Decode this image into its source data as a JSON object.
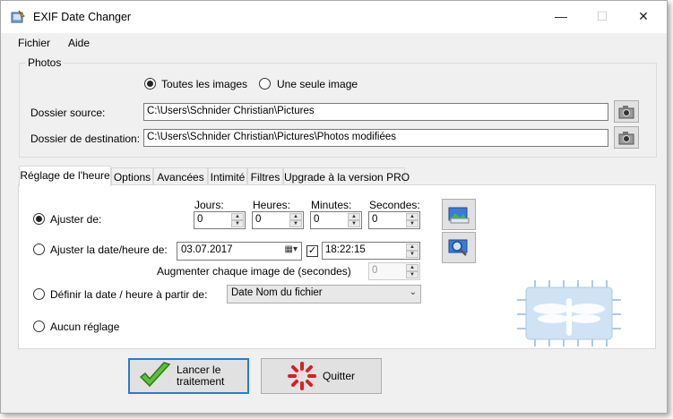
{
  "window": {
    "title": "EXIF Date Changer"
  },
  "menu": {
    "file": "Fichier",
    "help": "Aide"
  },
  "photos": {
    "group_label": "Photos",
    "mode_all": "Toutes les images",
    "mode_single": "Une seule image",
    "source_label": "Dossier source:",
    "source_value": "C:\\Users\\Schnider Christian\\Pictures",
    "dest_label": "Dossier de destination:",
    "dest_value": "C:\\Users\\Schnider Christian\\Pictures\\Photos modifiées"
  },
  "tabs": [
    "Réglage de l'heure",
    "Options",
    "Avancées",
    "Intimité",
    "Filtres",
    "Upgrade à la version PRO"
  ],
  "time": {
    "adjust_label": "Ajuster de:",
    "days_label": "Jours:",
    "days_value": "0",
    "hours_label": "Heures:",
    "hours_value": "0",
    "minutes_label": "Minutes:",
    "minutes_value": "0",
    "seconds_label": "Secondes:",
    "seconds_value": "0",
    "set_date_label": "Ajuster la date/heure de:",
    "date_value": "03.07.2017",
    "time_value": "18:22:15",
    "increment_label": "Augmenter chaque image de (secondes)",
    "increment_value": "0",
    "define_label": "Définir la date / heure à partir de:",
    "define_option": "Date Nom du fichier",
    "none_label": "Aucun réglage"
  },
  "buttons": {
    "run": "Lancer le traitement",
    "run_line1": "Lancer le",
    "run_line2": "traitement",
    "quit": "Quitter"
  },
  "colors": {
    "accent": "#2a7ac8",
    "window_bg": "#f0f0f0"
  }
}
